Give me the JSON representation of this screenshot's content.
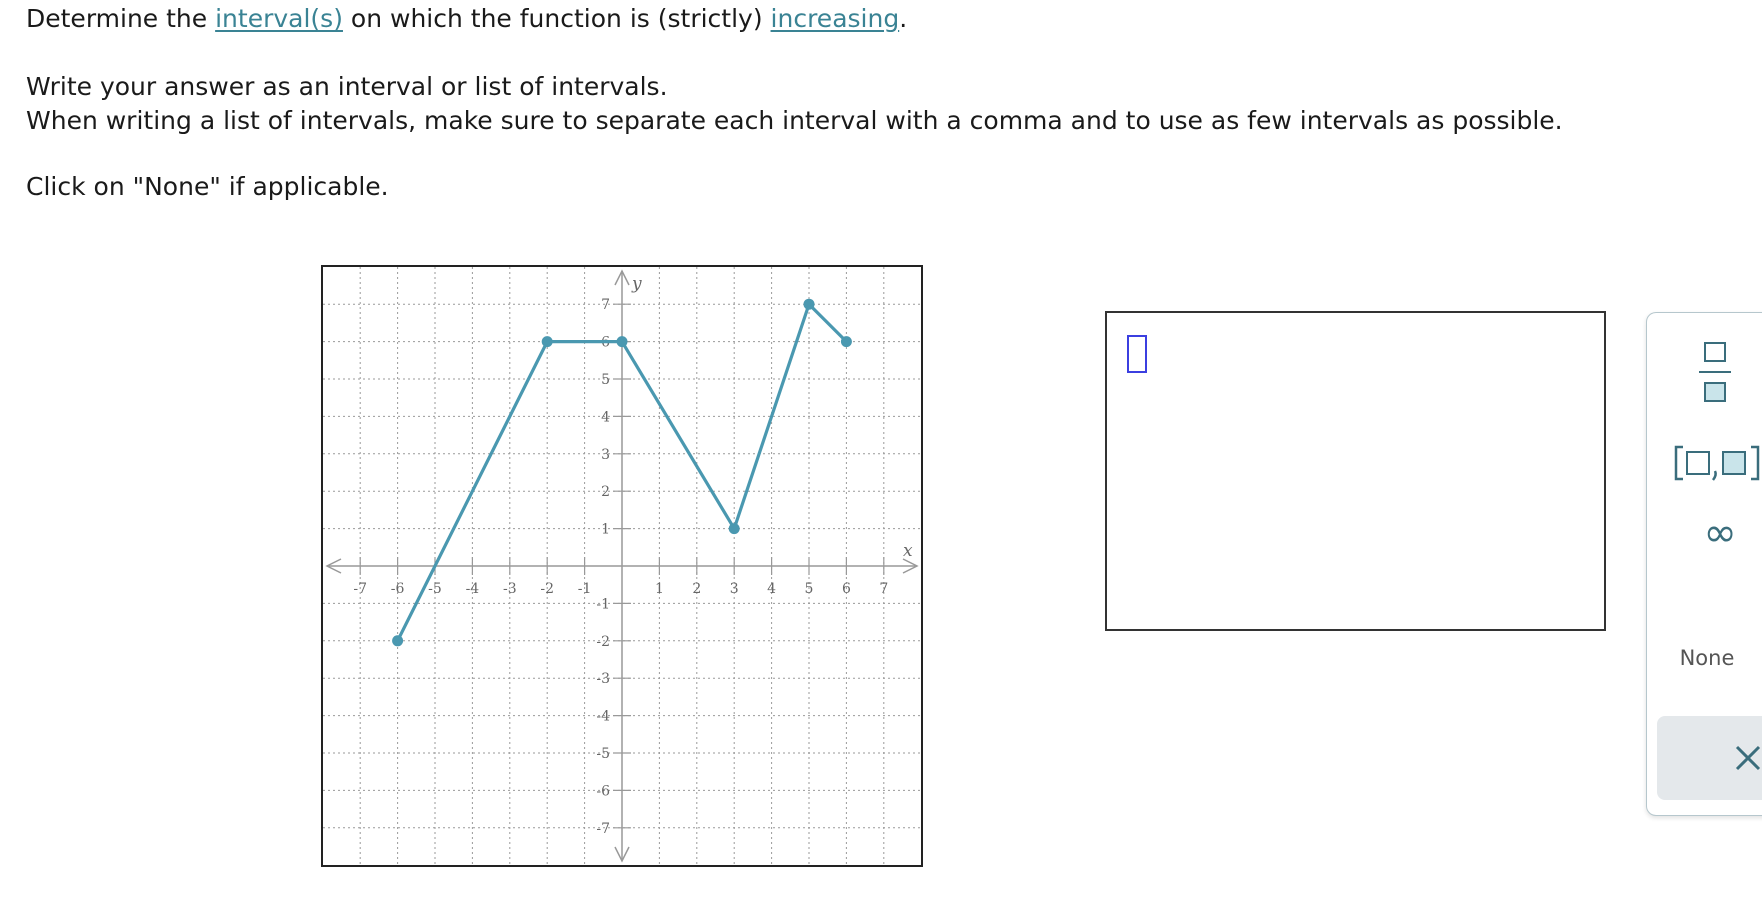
{
  "question": {
    "line1_pre": "Determine the ",
    "link_interval": "interval(s)",
    "line1_mid": " on which the function is (strictly) ",
    "link_increasing": "increasing",
    "line1_post": ".",
    "line2": "Write your answer as an interval or list of intervals.",
    "line3": "When writing a list of intervals, make sure to separate each interval with a comma and to use as few intervals as possible.",
    "line4": "Click on \"None\" if applicable."
  },
  "graph": {
    "x_label": "x",
    "y_label": "y",
    "x_ticks": [
      "-7",
      "-6",
      "-5",
      "-4",
      "-3",
      "-2",
      "-1",
      "1",
      "2",
      "3",
      "4",
      "5",
      "6",
      "7"
    ],
    "y_ticks": [
      "7",
      "6",
      "5",
      "4",
      "3",
      "2",
      "1",
      "-1",
      "-2",
      "-3",
      "-4",
      "-5",
      "-6",
      "-7"
    ],
    "range": {
      "xmin": -7,
      "xmax": 7,
      "ymin": -7,
      "ymax": 7
    },
    "curve_color": "#4a98b0",
    "grid_color": "#9a9a9a",
    "points": [
      [
        -6,
        -2
      ],
      [
        -2,
        6
      ],
      [
        0,
        6
      ],
      [
        3,
        1
      ],
      [
        5,
        7
      ],
      [
        6,
        6
      ]
    ],
    "endpoint_markers": [
      [
        -6,
        -2
      ],
      [
        -2,
        6
      ],
      [
        0,
        6
      ],
      [
        3,
        1
      ],
      [
        5,
        7
      ],
      [
        6,
        6
      ]
    ]
  },
  "answer": {
    "value": ""
  },
  "tools": {
    "fraction_icon": "fraction-icon",
    "interval_icon": "interval-icon",
    "infinity_symbol": "∞",
    "none_label": "None",
    "clear_icon": "close-icon",
    "accent_color": "#3a6d7c"
  }
}
